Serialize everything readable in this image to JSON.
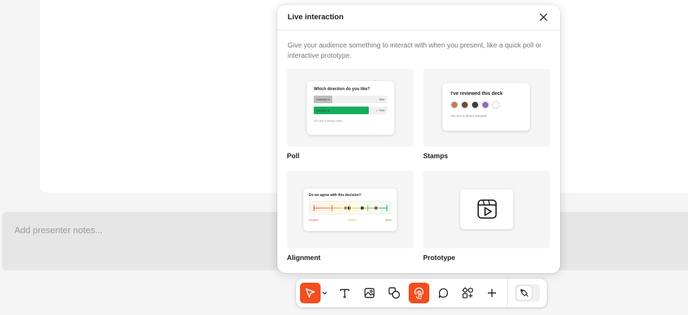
{
  "notes": {
    "placeholder": "Add presenter notes..."
  },
  "modal": {
    "title": "Live interaction",
    "description": "Give your audience something to interact with when you present, like a quick poll or interactive prototype.",
    "cards": [
      {
        "label": "Poll"
      },
      {
        "label": "Stamps"
      },
      {
        "label": "Alignment"
      },
      {
        "label": "Prototype"
      }
    ]
  },
  "poll_preview": {
    "question": "Which direction do you like?",
    "options": [
      {
        "label": "Direction A",
        "percent": "25%",
        "fraction": 0.25,
        "color": "#bdbdbd"
      },
      {
        "label": "Direction B",
        "percent": "✓ 75%",
        "fraction": 0.75,
        "color": "#14ae5c"
      }
    ],
    "footer": "You and 3 others voted"
  },
  "stamps_preview": {
    "title": "I've reviewed this deck",
    "avatar_colors": [
      "#c47a52",
      "#6b4a3a",
      "#3d3d3d",
      "#8e6bb3"
    ],
    "footer": "You and 3 others stamped"
  },
  "alignment_preview": {
    "question": "Do we agree with this decision?",
    "scale": {
      "left": "Disagree",
      "middle": "Neutral",
      "right": "Agree"
    },
    "colors": {
      "left": "#f24822",
      "middle": "#e8a500",
      "right": "#14ae5c"
    }
  },
  "prototype_preview": {
    "icon": "play-window-icon"
  },
  "toolbar": {
    "accent": "#f24e1e",
    "tools": [
      {
        "name": "move-tool",
        "icon": "cursor-icon",
        "active": true
      },
      {
        "name": "text-tool",
        "icon": "text-icon"
      },
      {
        "name": "image-tool",
        "icon": "image-icon"
      },
      {
        "name": "shape-tool",
        "icon": "shapes-icon"
      },
      {
        "name": "interaction-tool",
        "icon": "hand-tap-icon",
        "active": true
      },
      {
        "name": "comment-tool",
        "icon": "comment-icon"
      },
      {
        "name": "widgets-tool",
        "icon": "widgets-icon"
      },
      {
        "name": "add-tool",
        "icon": "plus-icon"
      }
    ]
  }
}
